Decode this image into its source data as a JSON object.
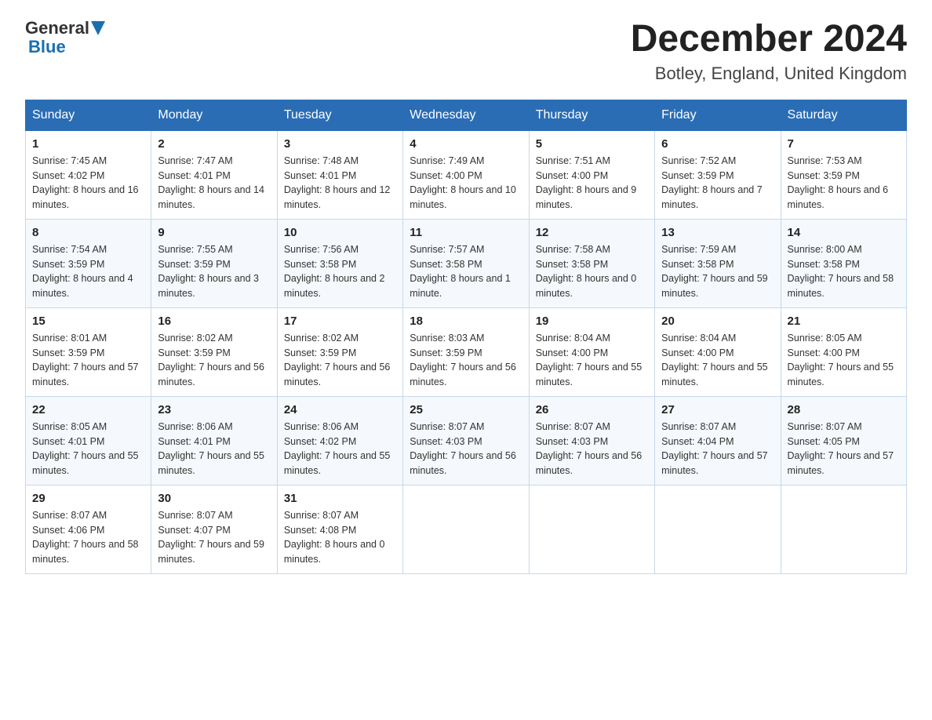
{
  "header": {
    "logo_general": "General",
    "logo_blue": "Blue",
    "title": "December 2024",
    "location": "Botley, England, United Kingdom"
  },
  "weekdays": [
    "Sunday",
    "Monday",
    "Tuesday",
    "Wednesday",
    "Thursday",
    "Friday",
    "Saturday"
  ],
  "weeks": [
    [
      {
        "day": "1",
        "sunrise": "7:45 AM",
        "sunset": "4:02 PM",
        "daylight": "8 hours and 16 minutes."
      },
      {
        "day": "2",
        "sunrise": "7:47 AM",
        "sunset": "4:01 PM",
        "daylight": "8 hours and 14 minutes."
      },
      {
        "day": "3",
        "sunrise": "7:48 AM",
        "sunset": "4:01 PM",
        "daylight": "8 hours and 12 minutes."
      },
      {
        "day": "4",
        "sunrise": "7:49 AM",
        "sunset": "4:00 PM",
        "daylight": "8 hours and 10 minutes."
      },
      {
        "day": "5",
        "sunrise": "7:51 AM",
        "sunset": "4:00 PM",
        "daylight": "8 hours and 9 minutes."
      },
      {
        "day": "6",
        "sunrise": "7:52 AM",
        "sunset": "3:59 PM",
        "daylight": "8 hours and 7 minutes."
      },
      {
        "day": "7",
        "sunrise": "7:53 AM",
        "sunset": "3:59 PM",
        "daylight": "8 hours and 6 minutes."
      }
    ],
    [
      {
        "day": "8",
        "sunrise": "7:54 AM",
        "sunset": "3:59 PM",
        "daylight": "8 hours and 4 minutes."
      },
      {
        "day": "9",
        "sunrise": "7:55 AM",
        "sunset": "3:59 PM",
        "daylight": "8 hours and 3 minutes."
      },
      {
        "day": "10",
        "sunrise": "7:56 AM",
        "sunset": "3:58 PM",
        "daylight": "8 hours and 2 minutes."
      },
      {
        "day": "11",
        "sunrise": "7:57 AM",
        "sunset": "3:58 PM",
        "daylight": "8 hours and 1 minute."
      },
      {
        "day": "12",
        "sunrise": "7:58 AM",
        "sunset": "3:58 PM",
        "daylight": "8 hours and 0 minutes."
      },
      {
        "day": "13",
        "sunrise": "7:59 AM",
        "sunset": "3:58 PM",
        "daylight": "7 hours and 59 minutes."
      },
      {
        "day": "14",
        "sunrise": "8:00 AM",
        "sunset": "3:58 PM",
        "daylight": "7 hours and 58 minutes."
      }
    ],
    [
      {
        "day": "15",
        "sunrise": "8:01 AM",
        "sunset": "3:59 PM",
        "daylight": "7 hours and 57 minutes."
      },
      {
        "day": "16",
        "sunrise": "8:02 AM",
        "sunset": "3:59 PM",
        "daylight": "7 hours and 56 minutes."
      },
      {
        "day": "17",
        "sunrise": "8:02 AM",
        "sunset": "3:59 PM",
        "daylight": "7 hours and 56 minutes."
      },
      {
        "day": "18",
        "sunrise": "8:03 AM",
        "sunset": "3:59 PM",
        "daylight": "7 hours and 56 minutes."
      },
      {
        "day": "19",
        "sunrise": "8:04 AM",
        "sunset": "4:00 PM",
        "daylight": "7 hours and 55 minutes."
      },
      {
        "day": "20",
        "sunrise": "8:04 AM",
        "sunset": "4:00 PM",
        "daylight": "7 hours and 55 minutes."
      },
      {
        "day": "21",
        "sunrise": "8:05 AM",
        "sunset": "4:00 PM",
        "daylight": "7 hours and 55 minutes."
      }
    ],
    [
      {
        "day": "22",
        "sunrise": "8:05 AM",
        "sunset": "4:01 PM",
        "daylight": "7 hours and 55 minutes."
      },
      {
        "day": "23",
        "sunrise": "8:06 AM",
        "sunset": "4:01 PM",
        "daylight": "7 hours and 55 minutes."
      },
      {
        "day": "24",
        "sunrise": "8:06 AM",
        "sunset": "4:02 PM",
        "daylight": "7 hours and 55 minutes."
      },
      {
        "day": "25",
        "sunrise": "8:07 AM",
        "sunset": "4:03 PM",
        "daylight": "7 hours and 56 minutes."
      },
      {
        "day": "26",
        "sunrise": "8:07 AM",
        "sunset": "4:03 PM",
        "daylight": "7 hours and 56 minutes."
      },
      {
        "day": "27",
        "sunrise": "8:07 AM",
        "sunset": "4:04 PM",
        "daylight": "7 hours and 57 minutes."
      },
      {
        "day": "28",
        "sunrise": "8:07 AM",
        "sunset": "4:05 PM",
        "daylight": "7 hours and 57 minutes."
      }
    ],
    [
      {
        "day": "29",
        "sunrise": "8:07 AM",
        "sunset": "4:06 PM",
        "daylight": "7 hours and 58 minutes."
      },
      {
        "day": "30",
        "sunrise": "8:07 AM",
        "sunset": "4:07 PM",
        "daylight": "7 hours and 59 minutes."
      },
      {
        "day": "31",
        "sunrise": "8:07 AM",
        "sunset": "4:08 PM",
        "daylight": "8 hours and 0 minutes."
      },
      null,
      null,
      null,
      null
    ]
  ]
}
